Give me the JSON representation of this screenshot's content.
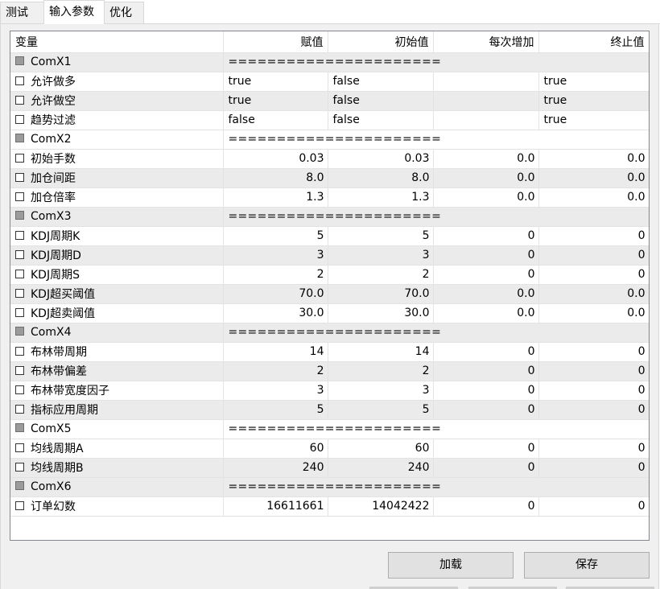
{
  "tabs": [
    "测试",
    "输入参数",
    "优化"
  ],
  "columns": [
    "变量",
    "赋值",
    "初始值",
    "每次增加",
    "终止值"
  ],
  "rows": [
    {
      "type": "group",
      "name": "ComX1",
      "sep": "======================"
    },
    {
      "type": "param",
      "name": "允许做多",
      "value": "true",
      "start": "false",
      "step": "",
      "stop": "true",
      "align": "left"
    },
    {
      "type": "param",
      "name": "允许做空",
      "value": "true",
      "start": "false",
      "step": "",
      "stop": "true",
      "align": "left"
    },
    {
      "type": "param",
      "name": "趋势过滤",
      "value": "false",
      "start": "false",
      "step": "",
      "stop": "true",
      "align": "left"
    },
    {
      "type": "group",
      "name": "ComX2",
      "sep": "======================"
    },
    {
      "type": "param",
      "name": "初始手数",
      "value": "0.03",
      "start": "0.03",
      "step": "0.0",
      "stop": "0.0",
      "align": "right"
    },
    {
      "type": "param",
      "name": "加仓间距",
      "value": "8.0",
      "start": "8.0",
      "step": "0.0",
      "stop": "0.0",
      "align": "right"
    },
    {
      "type": "param",
      "name": "加仓倍率",
      "value": "1.3",
      "start": "1.3",
      "step": "0.0",
      "stop": "0.0",
      "align": "right"
    },
    {
      "type": "group",
      "name": "ComX3",
      "sep": "======================"
    },
    {
      "type": "param",
      "name": "KDJ周期K",
      "value": "5",
      "start": "5",
      "step": "0",
      "stop": "0",
      "align": "right"
    },
    {
      "type": "param",
      "name": "KDJ周期D",
      "value": "3",
      "start": "3",
      "step": "0",
      "stop": "0",
      "align": "right"
    },
    {
      "type": "param",
      "name": "KDJ周期S",
      "value": "2",
      "start": "2",
      "step": "0",
      "stop": "0",
      "align": "right"
    },
    {
      "type": "param",
      "name": "KDJ超买阈值",
      "value": "70.0",
      "start": "70.0",
      "step": "0.0",
      "stop": "0.0",
      "align": "right"
    },
    {
      "type": "param",
      "name": "KDJ超卖阈值",
      "value": "30.0",
      "start": "30.0",
      "step": "0.0",
      "stop": "0.0",
      "align": "right"
    },
    {
      "type": "group",
      "name": "ComX4",
      "sep": "======================"
    },
    {
      "type": "param",
      "name": "布林带周期",
      "value": "14",
      "start": "14",
      "step": "0",
      "stop": "0",
      "align": "right"
    },
    {
      "type": "param",
      "name": "布林带偏差",
      "value": "2",
      "start": "2",
      "step": "0",
      "stop": "0",
      "align": "right"
    },
    {
      "type": "param",
      "name": "布林带宽度因子",
      "value": "3",
      "start": "3",
      "step": "0",
      "stop": "0",
      "align": "right"
    },
    {
      "type": "param",
      "name": "指标应用周期",
      "value": "5",
      "start": "5",
      "step": "0",
      "stop": "0",
      "align": "right"
    },
    {
      "type": "group",
      "name": "ComX5",
      "sep": "======================"
    },
    {
      "type": "param",
      "name": "均线周期A",
      "value": "60",
      "start": "60",
      "step": "0",
      "stop": "0",
      "align": "right"
    },
    {
      "type": "param",
      "name": "均线周期B",
      "value": "240",
      "start": "240",
      "step": "0",
      "stop": "0",
      "align": "right"
    },
    {
      "type": "group",
      "name": "ComX6",
      "sep": "======================"
    },
    {
      "type": "param",
      "name": "订单幻数",
      "value": "16611661",
      "start": "14042422",
      "step": "0",
      "stop": "0",
      "align": "right"
    }
  ],
  "buttons": {
    "load": "加载",
    "save": "保存"
  }
}
